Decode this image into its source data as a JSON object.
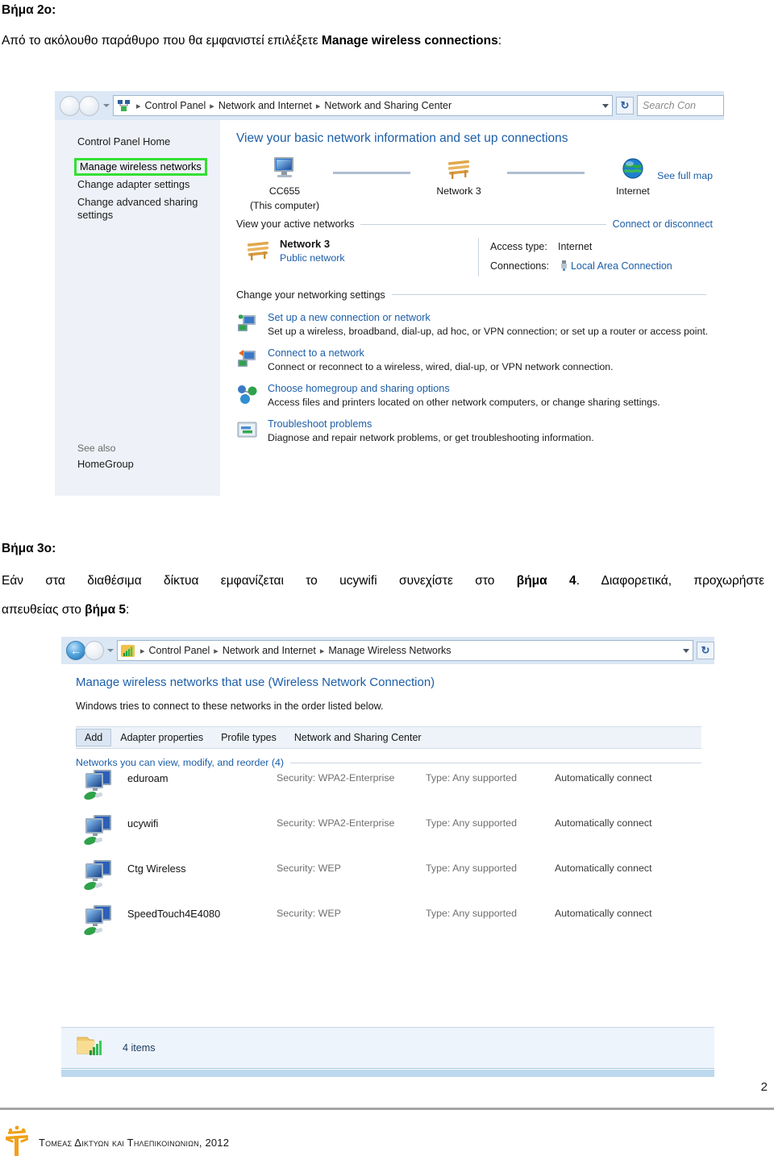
{
  "document": {
    "step2": {
      "heading": "Βήμα 2ο:",
      "paragraph_before": "Από το ακόλουθο παράθυρο που θα εμφανιστεί επιλέξετε ",
      "paragraph_bold": "Manage wireless connections",
      "paragraph_after": ":"
    },
    "step3": {
      "heading": "Βήμα 3ο:",
      "line1_a": "Εάν στα διαθέσιμα δίκτυα εμφανίζεται το ucywifi συνεχίστε στο ",
      "line1_b": "βήμα 4",
      "line1_c": ". Διαφορετικά, προχωρήστε",
      "line2_a": "απευθείας στο ",
      "line2_b": "βήμα 5",
      "line2_c": ":"
    },
    "footer": {
      "text": "Τομεασ Δικτυων και Τηλεπικοινωνιων, 2012",
      "page_number": "2",
      "logo": "tree-logo"
    }
  },
  "screenshot1": {
    "name": "Network and Sharing Center window",
    "addressbar": {
      "back_icon": "back-arrow-icon",
      "forward_icon": "forward-arrow-icon",
      "history_icon": "chevron-down-icon",
      "path_icon": "network-sharing-icon",
      "crumbs": [
        "Control Panel",
        "Network and Internet",
        "Network and Sharing Center"
      ],
      "separator": "▸",
      "dropdown_icon": "chevron-down-icon",
      "refresh_icon": "refresh-icon",
      "search_placeholder": "Search Con"
    },
    "sidebar": {
      "home_label": "Control Panel Home",
      "items": [
        {
          "label": "Manage wireless networks",
          "highlighted": true
        },
        {
          "label": "Change adapter settings",
          "highlighted": false
        },
        {
          "label": "Change advanced sharing settings",
          "highlighted": false
        }
      ],
      "see_also_label": "See also",
      "see_also_items": [
        "HomeGroup"
      ],
      "highlight_color": "#33e033"
    },
    "main": {
      "title": "View your basic network information and set up connections",
      "see_full_map": "See full map",
      "map_nodes": [
        {
          "icon": "computer-icon",
          "label": "CC655",
          "sublabel": "(This computer)"
        },
        {
          "icon": "bench-network-icon",
          "label": "Network  3",
          "sublabel": ""
        },
        {
          "icon": "globe-internet-icon",
          "label": "Internet",
          "sublabel": ""
        }
      ],
      "active_section_title": "View your active networks",
      "active_section_action": "Connect or disconnect",
      "active_network": {
        "icon": "bench-network-icon",
        "name": "Network  3",
        "type": "Public network",
        "access_type_key": "Access type:",
        "access_type_value": "Internet",
        "connections_key": "Connections:",
        "connections_icon": "lan-connection-icon",
        "connections_value": "Local Area Connection"
      },
      "settings_section_title": "Change your networking settings",
      "settings": [
        {
          "icon": "add-connection-icon",
          "title": "Set up a new connection or network",
          "desc": "Set up a wireless, broadband, dial-up, ad hoc, or VPN connection; or set up a router or access point."
        },
        {
          "icon": "connect-network-icon",
          "title": "Connect to a network",
          "desc": "Connect or reconnect to a wireless, wired, dial-up, or VPN network connection."
        },
        {
          "icon": "homegroup-icon",
          "title": "Choose homegroup and sharing options",
          "desc": "Access files and printers located on other network computers, or change sharing settings."
        },
        {
          "icon": "troubleshoot-icon",
          "title": "Troubleshoot problems",
          "desc": "Diagnose and repair network problems, or get troubleshooting information."
        }
      ]
    }
  },
  "screenshot2": {
    "name": "Manage Wireless Networks window",
    "addressbar": {
      "back_icon": "back-arrow-icon",
      "forward_icon": "forward-arrow-icon",
      "history_icon": "chevron-down-icon",
      "path_icon": "wireless-signal-icon",
      "crumbs": [
        "Control Panel",
        "Network and Internet",
        "Manage Wireless Networks"
      ],
      "separator": "▸",
      "dropdown_icon": "chevron-down-icon",
      "refresh_icon": "refresh-icon"
    },
    "title": "Manage wireless networks that use (Wireless Network Connection)",
    "subtitle": "Windows tries to connect to these networks in the order listed below.",
    "toolbar": [
      "Add",
      "Adapter properties",
      "Profile types",
      "Network and Sharing Center"
    ],
    "group_label": "Networks you can view, modify, and reorder (4)",
    "networks": [
      {
        "icon": "wireless-profile-icon",
        "name": "eduroam",
        "security": "Security: WPA2-Enterprise",
        "type": "Type: Any supported",
        "connect": "Automatically connect"
      },
      {
        "icon": "wireless-profile-icon",
        "name": "ucywifi",
        "security": "Security: WPA2-Enterprise",
        "type": "Type: Any supported",
        "connect": "Automatically connect"
      },
      {
        "icon": "wireless-profile-icon",
        "name": "Ctg Wireless",
        "security": "Security: WEP",
        "type": "Type: Any supported",
        "connect": "Automatically connect"
      },
      {
        "icon": "wireless-profile-icon",
        "name": "SpeedTouch4E4080",
        "security": "Security: WEP",
        "type": "Type: Any supported",
        "connect": "Automatically connect"
      }
    ],
    "statusbar": {
      "icon": "folder-wireless-icon",
      "label": "4 items"
    }
  }
}
